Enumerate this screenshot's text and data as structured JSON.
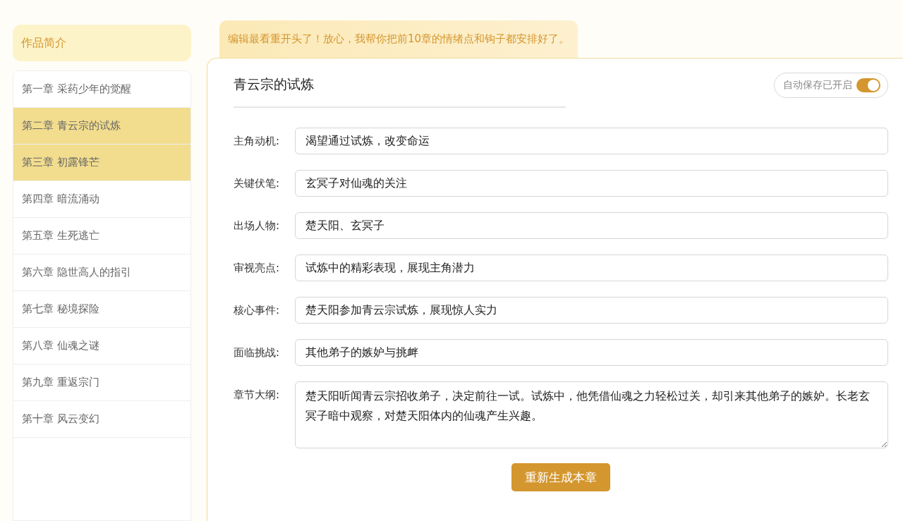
{
  "sidebar": {
    "intro": "作品简介",
    "chapters": [
      {
        "label": "第一章 采药少年的觉醒",
        "selected": false
      },
      {
        "label": "第二章 青云宗的试炼",
        "selected": true
      },
      {
        "label": "第三章 初露锋芒",
        "selected": true
      },
      {
        "label": "第四章 暗流涌动",
        "selected": false
      },
      {
        "label": "第五章 生死逃亡",
        "selected": false
      },
      {
        "label": "第六章 隐世高人的指引",
        "selected": false
      },
      {
        "label": "第七章 秘境探险",
        "selected": false
      },
      {
        "label": "第八章 仙魂之谜",
        "selected": false
      },
      {
        "label": "第九章 重返宗门",
        "selected": false
      },
      {
        "label": "第十章 风云变幻",
        "selected": false
      }
    ]
  },
  "banner": "编辑最看重开头了！放心，我帮你把前10章的情绪点和钩子都安排好了。",
  "editor": {
    "title": "青云宗的试炼",
    "autosave": {
      "label": "自动保存已开启",
      "on": true
    },
    "fields": [
      {
        "kind": "line",
        "label": "主角动机:",
        "value": "渴望通过试炼，改变命运"
      },
      {
        "kind": "line",
        "label": "关键伏笔:",
        "value": "玄冥子对仙魂的关注"
      },
      {
        "kind": "line",
        "label": "出场人物:",
        "value": "楚天阳、玄冥子"
      },
      {
        "kind": "line",
        "label": "审视亮点:",
        "value": "试炼中的精彩表现，展现主角潜力"
      },
      {
        "kind": "line",
        "label": "核心事件:",
        "value": "楚天阳参加青云宗试炼，展现惊人实力"
      },
      {
        "kind": "line",
        "label": "面临挑战:",
        "value": "其他弟子的嫉妒与挑衅"
      },
      {
        "kind": "area",
        "label": "章节大纲:",
        "value": "楚天阳听闻青云宗招收弟子，决定前往一试。试炼中，他凭借仙魂之力轻松过关，却引来其他弟子的嫉妒。长老玄冥子暗中观察，对楚天阳体内的仙魂产生兴趣。"
      }
    ],
    "button": "重新生成本章"
  }
}
